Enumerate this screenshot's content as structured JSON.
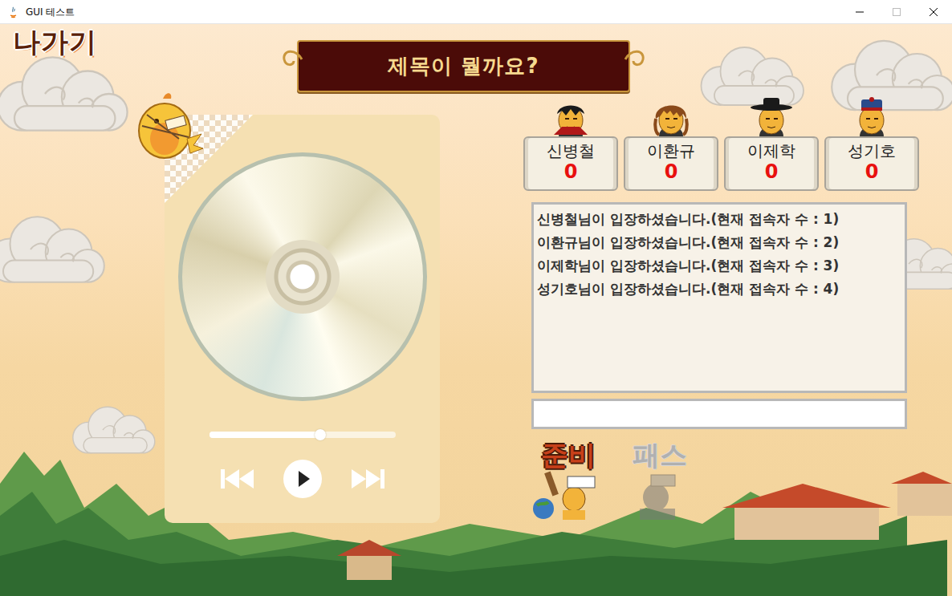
{
  "window": {
    "title": "GUI 테스트"
  },
  "exit_button": {
    "label": "나가기"
  },
  "banner": {
    "title": "제목이 뭘까요?"
  },
  "player": {
    "level": 0.6,
    "playing": false
  },
  "players": [
    {
      "name": "신병철",
      "score": "0"
    },
    {
      "name": "이환규",
      "score": "0"
    },
    {
      "name": "이제학",
      "score": "0"
    },
    {
      "name": "성기호",
      "score": "0"
    }
  ],
  "chat": {
    "messages": [
      "신병철님이 입장하셨습니다.(현재 접속자 수 : 1)",
      "이환규님이 입장하셨습니다.(현재 접속자 수 : 2)",
      "이제학님이 입장하셨습니다.(현재 접속자 수 : 3)",
      "성기호님이 입장하셨습니다.(현재 접속자 수 : 4)"
    ]
  },
  "input": {
    "value": ""
  },
  "buttons": [
    {
      "label": "준비",
      "disabled": false
    },
    {
      "label": "패스",
      "disabled": true
    }
  ]
}
